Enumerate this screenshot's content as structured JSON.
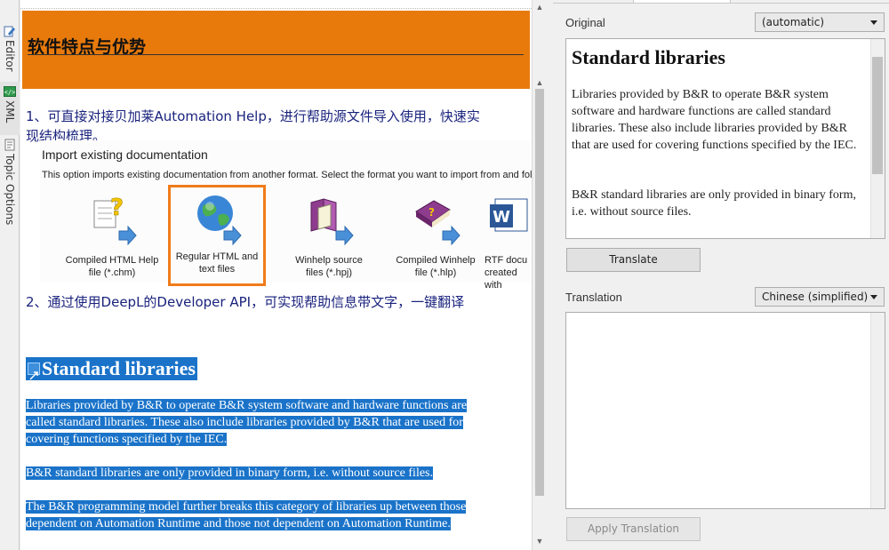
{
  "side_tabs": [
    {
      "label": "Editor",
      "icon": "edit-icon"
    },
    {
      "label": "XML",
      "icon": "xml-icon"
    },
    {
      "label": "Topic Options",
      "icon": "topic-options-icon"
    }
  ],
  "document": {
    "banner_title": "软件特点与优势",
    "feature1_line1": "1、可直接对接贝加莱Automation Help，进行帮助源文件导入使用，快速实",
    "feature1_line2": "现结构梳理。",
    "import_title": "Import existing documentation",
    "import_desc": "This option imports existing documentation from another format. Select the format you want to import from and fol",
    "formats": [
      {
        "line1": "Compiled HTML Help",
        "line2": "file (*.chm)",
        "icon": "chm-help-icon"
      },
      {
        "line1": "Regular HTML and",
        "line2": "text files",
        "icon": "globe-icon"
      },
      {
        "line1": "Winhelp source",
        "line2": "files (*.hpj)",
        "icon": "winhelp-book-icon"
      },
      {
        "line1": "Compiled Winhelp",
        "line2": "file (*.hlp)",
        "icon": "winhelp-compiled-icon"
      },
      {
        "line1": "RTF docu",
        "line2": "created with",
        "icon": "word-icon"
      }
    ],
    "feature2": "2、通过使用DeepL的Developer API，可实现帮助信息带文字，一键翻译",
    "selected_heading": "Standard libraries",
    "para1_lines": [
      "Libraries provided by B&R to operate B&R system software and hardware functions are",
      "called standard libraries. These also include libraries provided by B&R that are used for",
      "covering functions specified by the IEC."
    ],
    "para2_lines": [
      "B&R standard libraries are only provided in binary form, i.e. without source files."
    ],
    "para3_lines": [
      "The B&R programming model further breaks this category of libraries up between those",
      "dependent on Automation Runtime and those not dependent on Automation Runtime."
    ]
  },
  "panel": {
    "original_label": "Original",
    "original_lang": "(automatic)",
    "original_heading": "Standard libraries",
    "original_para1": "Libraries provided by B&R to operate B&R system software and hardware functions are called standard libraries. These also include libraries provided by B&R that are used for covering functions specified by the IEC.",
    "original_para2": "B&R standard libraries are only provided in binary form, i.e. without source files.",
    "translate_button": "Translate",
    "translation_label": "Translation",
    "translation_lang": "Chinese (simplified)",
    "translation_text": "",
    "apply_button": "Apply Translation"
  },
  "colors": {
    "banner": "#e87a0c",
    "selection": "#1a73c9",
    "highlight_border": "#f07b1a",
    "feature_text": "#1a237e"
  }
}
